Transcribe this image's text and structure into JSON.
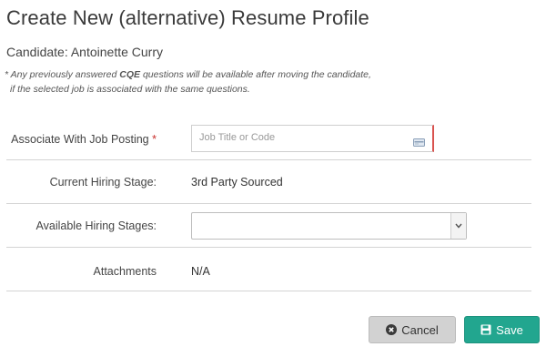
{
  "dialog": {
    "title": "Create New (alternative) Resume Profile",
    "candidate": "Candidate: Antoinette Curry",
    "note_part1": "* Any previously answered ",
    "note_bold": "CQE",
    "note_part2": " questions will be available after moving the candidate,",
    "note_line2": "if the selected job is associated with the same questions."
  },
  "form": {
    "job_posting": {
      "label": "Associate With Job Posting",
      "required_mark": "*",
      "placeholder": "Job Title or Code",
      "icon": "card-icon"
    },
    "current_stage": {
      "label": "Current Hiring Stage:",
      "value": "3rd Party Sourced"
    },
    "available_stages": {
      "label": "Available Hiring Stages:",
      "selected": "",
      "icon": "chevron-down-icon"
    },
    "attachments": {
      "label": "Attachments",
      "value": "N/A"
    }
  },
  "buttons": {
    "cancel": {
      "label": "Cancel",
      "icon": "close-circle-icon"
    },
    "save": {
      "label": "Save",
      "icon": "floppy-disk-icon"
    }
  },
  "colors": {
    "save_button": "#22a68f",
    "cancel_button": "#d2d2d2",
    "required": "#c9302c"
  }
}
